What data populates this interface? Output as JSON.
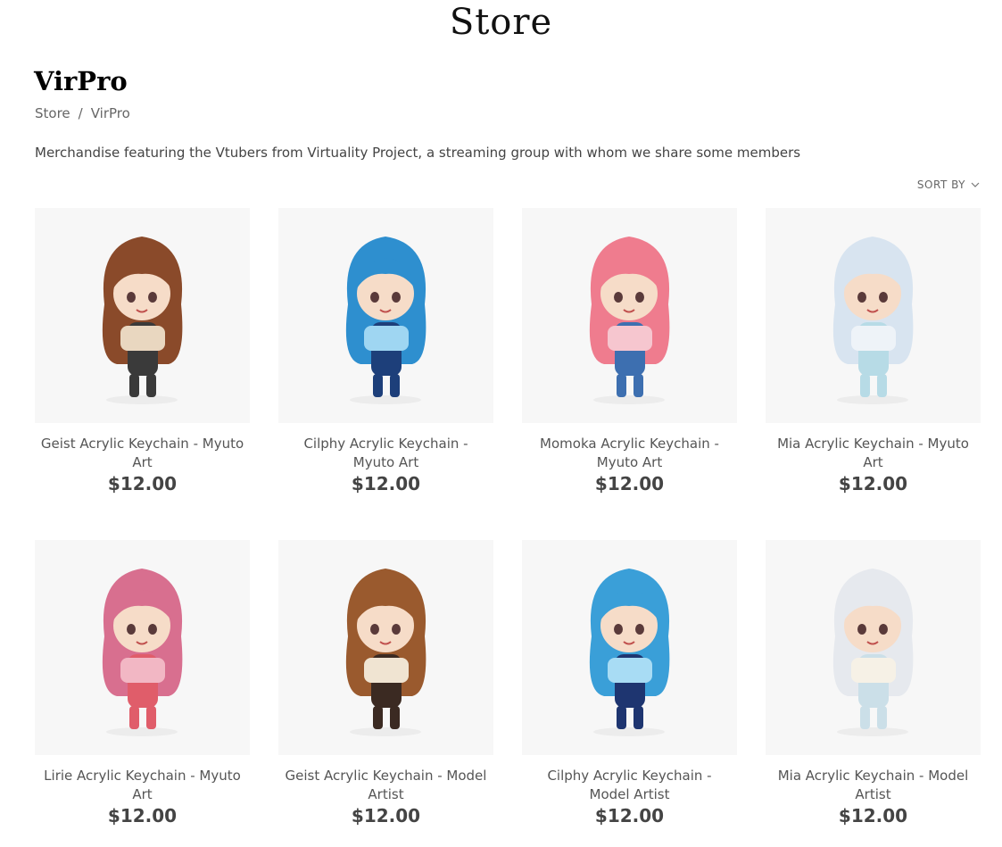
{
  "header": {
    "site_title": "Store"
  },
  "page": {
    "title": "VirPro",
    "breadcrumb": [
      "Store",
      "/",
      "VirPro"
    ],
    "description": "Merchandise featuring the Vtubers from Virtuality Project, a streaming group with whom we share some members",
    "sort_label": "SORT BY"
  },
  "products": [
    {
      "name": "Geist Acrylic Keychain - Myuto Art",
      "price": "$12.00",
      "hair": "#8a4a2a",
      "accent": "#e9d7c0",
      "outfit": "#3a3a3a"
    },
    {
      "name": "Cilphy Acrylic Keychain - Myuto Art",
      "price": "$12.00",
      "hair": "#2e8fcf",
      "accent": "#9fd6f2",
      "outfit": "#1d3f7a"
    },
    {
      "name": "Momoka Acrylic Keychain - Myuto Art",
      "price": "$12.00",
      "hair": "#ef7c8e",
      "accent": "#f6c6cf",
      "outfit": "#3d6fb0"
    },
    {
      "name": "Mia Acrylic Keychain - Myuto Art",
      "price": "$12.00",
      "hair": "#d8e4f0",
      "accent": "#eef3f8",
      "outfit": "#b7dbe6"
    },
    {
      "name": "Lirie Acrylic Keychain - Myuto Art",
      "price": "$12.00",
      "hair": "#d86f8f",
      "accent": "#f2b7c4",
      "outfit": "#e05d6a"
    },
    {
      "name": "Geist Acrylic Keychain - Model Artist",
      "price": "$12.00",
      "hair": "#9a5a2e",
      "accent": "#f0e4d2",
      "outfit": "#3b2a22"
    },
    {
      "name": "Cilphy Acrylic Keychain - Model Artist",
      "price": "$12.00",
      "hair": "#3a9fd8",
      "accent": "#a8dcf4",
      "outfit": "#1e3570"
    },
    {
      "name": "Mia Acrylic Keychain - Model Artist",
      "price": "$12.00",
      "hair": "#e6e9ee",
      "accent": "#f6f1e6",
      "outfit": "#cbdfe8"
    }
  ]
}
